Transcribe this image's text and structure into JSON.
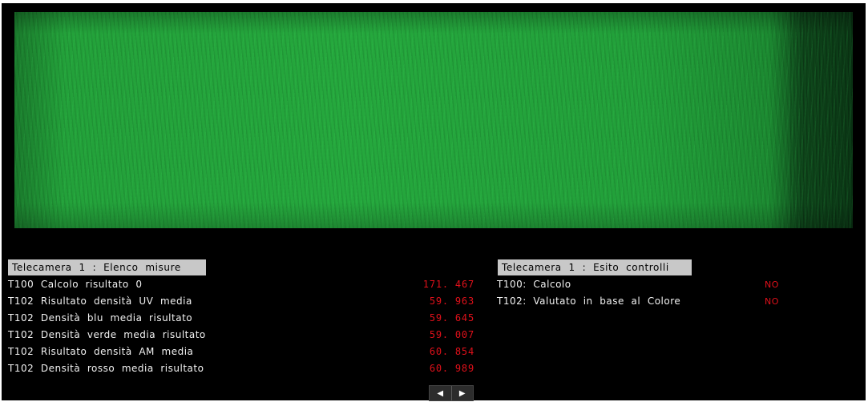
{
  "measures": {
    "header": "Telecamera  1  :  Elenco  misure",
    "rows": [
      {
        "label": "T100  Calcolo  risultato  0",
        "value": "171. 467"
      },
      {
        "label": "T102  Risultato  densità  UV  media",
        "value": "59. 963"
      },
      {
        "label": "T102  Densità  blu  media  risultato",
        "value": "59. 645"
      },
      {
        "label": "T102  Densità  verde  media  risultato",
        "value": "59. 007"
      },
      {
        "label": "T102  Risultato  densità  AM  media",
        "value": "60. 854"
      },
      {
        "label": "T102  Densità  rosso  media  risultato",
        "value": "60. 989"
      }
    ]
  },
  "results": {
    "header": "Telecamera  1  :  Esito  controlli",
    "rows": [
      {
        "label": "T100:  Calcolo",
        "value": "NO"
      },
      {
        "label": "T102:  Valutato  in  base  al  Colore",
        "value": "NO"
      }
    ]
  },
  "nav": {
    "prev_icon": "◀",
    "next_icon": "▶"
  },
  "colors": {
    "value_red": "#e0101a",
    "header_gray": "#c8c8c8",
    "background": "#000000",
    "camera_green": "#25a83d"
  }
}
